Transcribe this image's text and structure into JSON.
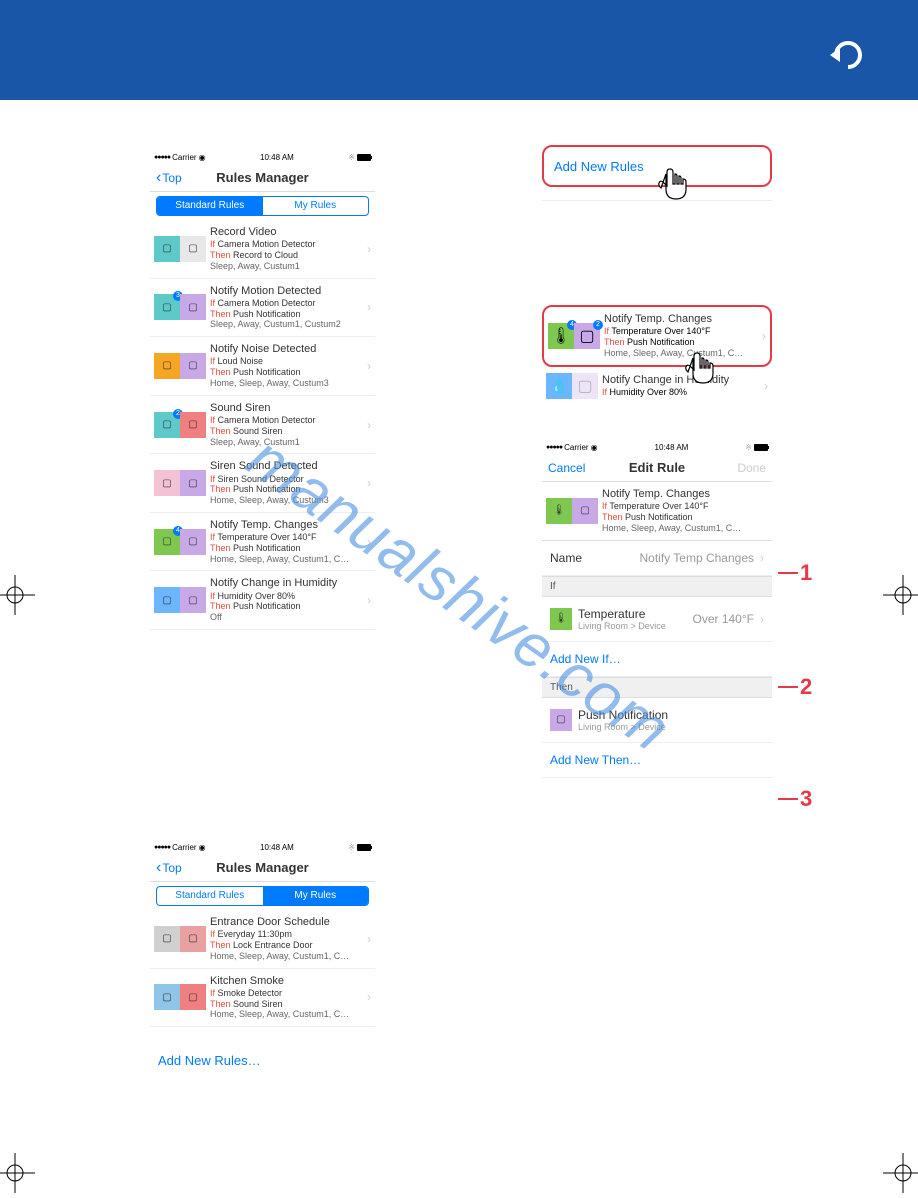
{
  "header": {},
  "watermark": "manualshive.com",
  "status": {
    "carrier": "Carrier",
    "time": "10:48 AM",
    "dots": "●●●●●"
  },
  "nav": {
    "back": "Top",
    "title": "Rules Manager",
    "edit_title": "Edit Rule",
    "cancel": "Cancel",
    "done": "Done"
  },
  "tabs": {
    "standard": "Standard Rules",
    "my": "My Rules"
  },
  "kw": {
    "if": "If",
    "then": "Then"
  },
  "rules_std": [
    {
      "title": "Record Video",
      "if": "Camera Motion Detector",
      "then": "Record to Cloud",
      "modes": "Sleep, Away, Custum1",
      "icons": [
        "teal",
        "white"
      ],
      "badge": ""
    },
    {
      "title": "Notify Motion Detected",
      "if": "Camera Motion Detector",
      "then": "Push Notification",
      "modes": "Sleep, Away, Custum1, Custum2",
      "icons": [
        "teal",
        "purple"
      ],
      "badge": "3"
    },
    {
      "title": "Notify Noise Detected",
      "if": "Loud Noise",
      "then": "Push Notification",
      "modes": "Home, Sleep, Away, Custum3",
      "icons": [
        "orange",
        "purple"
      ],
      "badge": ""
    },
    {
      "title": "Sound Siren",
      "if": "Camera Motion Detector",
      "then": "Sound Siren",
      "modes": "Sleep, Away, Custum1",
      "icons": [
        "teal",
        "red"
      ],
      "badge": "2"
    },
    {
      "title": "Siren Sound Detected",
      "if": "Siren Sound Detector",
      "then": "Push Notification",
      "modes": "Home, Sleep, Away, Custum3",
      "icons": [
        "pink",
        "purple"
      ],
      "badge": ""
    },
    {
      "title": "Notify Temp. Changes",
      "if": "Temperature Over 140°F",
      "then": "Push Notification",
      "modes": "Home, Sleep, Away, Custum1, C…",
      "icons": [
        "green",
        "purple"
      ],
      "badge": "4   2"
    },
    {
      "title": "Notify Change in Humidity",
      "if": "Humidity Over 80%",
      "then": "Push Notification",
      "modes": "Off",
      "icons": [
        "blue",
        "purple"
      ],
      "badge": ""
    }
  ],
  "rules_my": [
    {
      "title": "Entrance Door Schedule",
      "if": "Everyday 11:30pm",
      "then": "Lock Entrance Door",
      "modes": "Home, Sleep, Away, Custum1, C…",
      "icons": [
        "gray",
        "red2"
      ],
      "badge": ""
    },
    {
      "title": "Kitchen Smoke",
      "if": "Smoke Detector",
      "then": "Sound Siren",
      "modes": "Home, Sleep, Away, Custum1, C…",
      "icons": [
        "blue2",
        "red"
      ],
      "badge": ""
    }
  ],
  "add_new_rules": "Add New Rules…",
  "add_new_rules_btn": "Add New Rules",
  "callout_rule": {
    "title": "Notify Temp. Changes",
    "if": "Temperature Over 140°F",
    "then": "Push Notification",
    "modes": "Home, Sleep, Away, Custum1, C…"
  },
  "callout_rule2": {
    "title": "Notify Change in Humidity",
    "if": "Humidity Over 80%"
  },
  "edit": {
    "header_rule": {
      "title": "Notify Temp. Changes",
      "if": "Temperature Over 140°F",
      "then": "Push Notification",
      "modes": "Home, Sleep, Away, Custum1, C…"
    },
    "name_label": "Name",
    "name_value": "Notify Temp Changes",
    "if_header": "If",
    "if_item": {
      "title": "Temperature",
      "sub": "Living Room > Device",
      "value": "Over 140°F"
    },
    "add_if": "Add New If…",
    "then_header": "Then",
    "then_item": {
      "title": "Push Notification",
      "sub": "Living Room > Device"
    },
    "add_then": "Add New Then…"
  },
  "labels": {
    "1": "1",
    "2": "2",
    "3": "3"
  }
}
